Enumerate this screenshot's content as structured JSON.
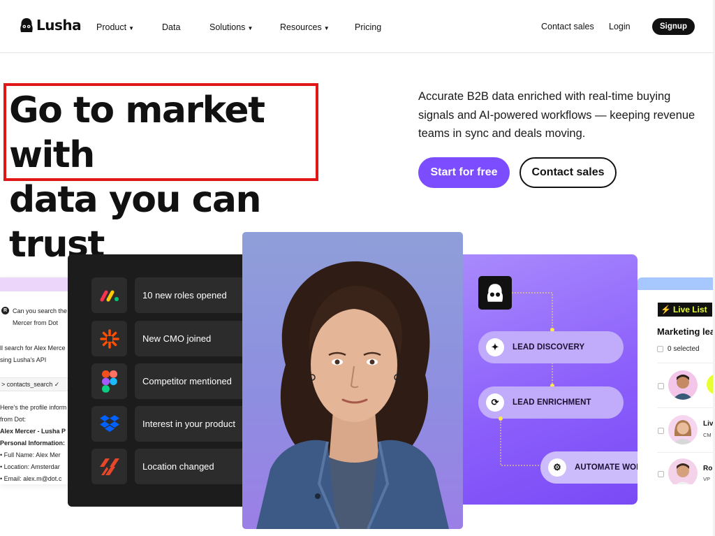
{
  "brand": {
    "name": "Lusha",
    "accent": "#7c4dff",
    "highlight_box": "#e11616"
  },
  "nav": {
    "items": [
      {
        "label": "Product",
        "dropdown": true
      },
      {
        "label": "Data",
        "dropdown": false
      },
      {
        "label": "Solutions",
        "dropdown": true
      },
      {
        "label": "Resources",
        "dropdown": true
      },
      {
        "label": "Pricing",
        "dropdown": false
      }
    ],
    "contact_sales": "Contact sales",
    "login": "Login",
    "signup": "Signup"
  },
  "hero": {
    "headline_line1": "Go to market with",
    "headline_line2": "data you can trust",
    "subtext": "Accurate B2B data enriched with real-time buying signals and AI-powered workflows — keeping revenue teams in sync and deals moving.",
    "cta_primary": "Start for free",
    "cta_secondary": "Contact sales"
  },
  "chat": {
    "avatar_letter": "R",
    "query_line1": "Can you search the",
    "query_line2": "Mercer from Dot",
    "reply_line1": "ll search for Alex Merce",
    "reply_line2": "sing Lusha's API",
    "command": "> contacts_search ✓",
    "profile_line1": "Here's the profile inform",
    "profile_line2": "from Dot:",
    "profile_name": "Alex Mercer - Lusha P",
    "personal_header": "Personal Information:",
    "bullet_name": "• Full Name: Alex Mer",
    "bullet_location": "• Location: Amsterdar",
    "bullet_email": "• Email: alex.m@dot.c"
  },
  "signals": {
    "items": [
      {
        "label": "10 new roles opened",
        "icon": "monday-logo-icon"
      },
      {
        "label": "New CMO joined",
        "icon": "zapier-logo-icon"
      },
      {
        "label": "Competitor mentioned",
        "icon": "figma-logo-icon"
      },
      {
        "label": "Interest in your  product",
        "icon": "dropbox-logo-icon"
      },
      {
        "label": "Location changed",
        "icon": "stripes-logo-icon"
      }
    ]
  },
  "workflow": {
    "steps": [
      {
        "label": "LEAD DISCOVERY",
        "icon": "sparkle-icon"
      },
      {
        "label": "LEAD ENRICHMENT",
        "icon": "refresh-check-icon"
      },
      {
        "label": "AUTOMATE WOR",
        "icon": "gear-icon"
      }
    ]
  },
  "live_list": {
    "badge": "Live List",
    "title": "Marketing lea",
    "selected": "0 selected",
    "rows": [
      {
        "name": "",
        "role": ""
      },
      {
        "name": "Liv",
        "role": "CM"
      },
      {
        "name": "Ro",
        "role": "VP"
      }
    ]
  }
}
